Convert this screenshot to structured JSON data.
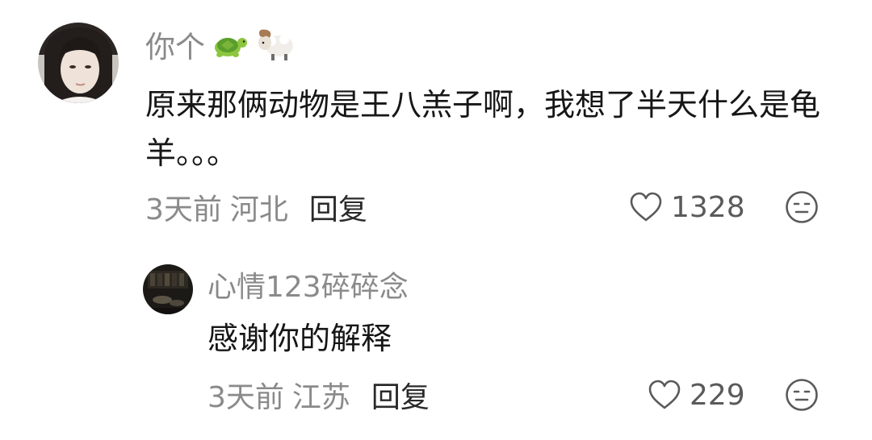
{
  "comments": [
    {
      "username": "你个",
      "username_emojis": [
        "turtle-icon",
        "ram-icon"
      ],
      "text": "原来那俩动物是王八羔子啊，我想了半天什么是龟羊。。。",
      "time": "3天前",
      "location": "河北",
      "reply_label": "回复",
      "likes": "1328",
      "reaction_icon": "neutral-face-icon"
    },
    {
      "username": "心情123碎碎念",
      "text": "感谢你的解释",
      "time": "3天前",
      "location": "江苏",
      "reply_label": "回复",
      "likes": "229",
      "reaction_icon": "neutral-face-icon"
    }
  ],
  "colors": {
    "secondary_text": "#8a8a8a",
    "primary_text": "#161616",
    "icon_stroke": "#5a5a5a"
  }
}
